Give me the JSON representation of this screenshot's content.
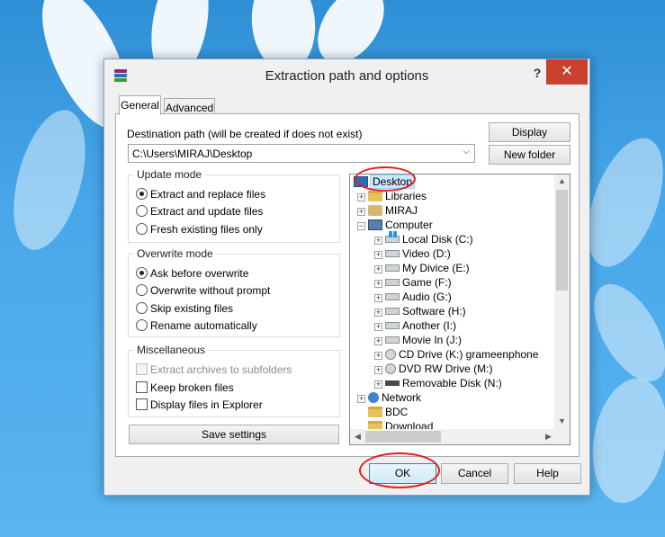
{
  "window": {
    "title": "Extraction path and options",
    "help": "?",
    "close": "✕"
  },
  "tabs": [
    {
      "label": "General"
    },
    {
      "label": "Advanced"
    }
  ],
  "destination": {
    "label": "Destination path (will be created if does not exist)",
    "value": "C:\\Users\\MIRAJ\\Desktop",
    "display_button": "Display",
    "new_folder_button": "New folder"
  },
  "update_mode": {
    "title": "Update mode",
    "options": [
      {
        "label": "Extract and replace files",
        "selected": true
      },
      {
        "label": "Extract and update files",
        "selected": false
      },
      {
        "label": "Fresh existing files only",
        "selected": false
      }
    ]
  },
  "overwrite_mode": {
    "title": "Overwrite mode",
    "options": [
      {
        "label": "Ask before overwrite",
        "selected": true
      },
      {
        "label": "Overwrite without prompt",
        "selected": false
      },
      {
        "label": "Skip existing files",
        "selected": false
      },
      {
        "label": "Rename automatically",
        "selected": false
      }
    ]
  },
  "miscellaneous": {
    "title": "Miscellaneous",
    "options": [
      {
        "label": "Extract archives to subfolders",
        "checked": false,
        "disabled": true
      },
      {
        "label": "Keep broken files",
        "checked": false,
        "disabled": false
      },
      {
        "label": "Display files in Explorer",
        "checked": false,
        "disabled": false
      }
    ]
  },
  "save_settings_button": "Save settings",
  "tree": {
    "items": [
      {
        "label": "Desktop",
        "icon": "desktop-icon",
        "selected": true
      },
      {
        "label": "Libraries",
        "icon": "folder-icon"
      },
      {
        "label": "MIRAJ",
        "icon": "user-icon"
      },
      {
        "label": "Computer",
        "icon": "computer-icon"
      },
      {
        "label": "Local Disk (C:)",
        "icon": "drive-icon"
      },
      {
        "label": "Video (D:)",
        "icon": "drive-icon"
      },
      {
        "label": "My Divice (E:)",
        "icon": "drive-icon"
      },
      {
        "label": "Game (F:)",
        "icon": "drive-icon"
      },
      {
        "label": "Audio (G:)",
        "icon": "drive-icon"
      },
      {
        "label": "Software (H:)",
        "icon": "drive-icon"
      },
      {
        "label": "Another (I:)",
        "icon": "drive-icon"
      },
      {
        "label": "Movie In (J:)",
        "icon": "drive-icon"
      },
      {
        "label": "CD Drive (K:) grameenphone",
        "icon": "cd-icon"
      },
      {
        "label": "DVD RW Drive (M:)",
        "icon": "cd-icon"
      },
      {
        "label": "Removable Disk (N:)",
        "icon": "usb-drive-icon"
      },
      {
        "label": "Network",
        "icon": "network-icon"
      },
      {
        "label": "BDC",
        "icon": "folder-icon"
      },
      {
        "label": "Download",
        "icon": "folder-icon"
      }
    ]
  },
  "footer": {
    "ok": "OK",
    "cancel": "Cancel",
    "help": "Help"
  },
  "colors": {
    "close_button": "#c7432f",
    "annotation": "#e0201b",
    "wallpaper": "#49a8ea"
  }
}
